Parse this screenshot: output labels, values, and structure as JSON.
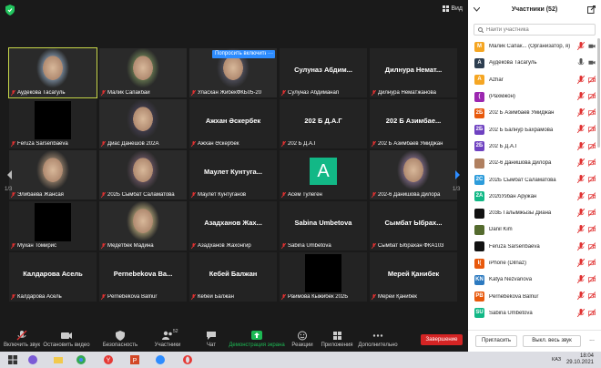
{
  "topbar": {
    "view_label": "Вид"
  },
  "ask_button": {
    "label": "Попросить включить",
    "more": "···"
  },
  "grid": {
    "page_left": "1/3",
    "page_right": "1/3",
    "tiles": [
      {
        "name": "Аудекова Тасагуль",
        "type": "photo",
        "active": true
      },
      {
        "name": "Малик Сапакбай",
        "type": "photo"
      },
      {
        "name": "Уласхан ЖибекФКБ05-20",
        "type": "photo"
      },
      {
        "name": "Сулуназ Абдиманап",
        "center": "Сулуназ Абдим..."
      },
      {
        "name": "Дилнура Нематжанова",
        "center": "Дилнура Немат..."
      },
      {
        "name": "Feruza Sarsenbaeva",
        "type": "black"
      },
      {
        "name": "Диас Данешов 202А",
        "type": "photo"
      },
      {
        "name": "Ажхан Әскербек",
        "center": "Ажхан Әскербек"
      },
      {
        "name": "202 Б Д.А.Г",
        "center": "202 Б Д.А.Г"
      },
      {
        "name": "202 Б Азимбаев Умиджан",
        "center": "202 Б Азимбае..."
      },
      {
        "name": "Элибаева Жансая",
        "type": "photo"
      },
      {
        "name": "202Б Сымбат Саламатова",
        "type": "photo"
      },
      {
        "name": "Маулет Кунтуганов",
        "center": "Маулет Кунтуга..."
      },
      {
        "name": "Асем Тулеген",
        "type": "avatar",
        "initial": "A"
      },
      {
        "name": "202-6 Данишова Дилора",
        "type": "photo"
      },
      {
        "name": "Мухан Томирис",
        "type": "black"
      },
      {
        "name": "Медетбек Мадина",
        "type": "photo"
      },
      {
        "name": "Азадханов Жахонгир",
        "center": "Азадханов Жах..."
      },
      {
        "name": "Sabina Umbetova",
        "center": "Sabina Umbetova"
      },
      {
        "name": "Сымбат Ыбрахан ФКА103",
        "center": "Сымбат Ыбрах..."
      },
      {
        "name": "Калдарова Асель",
        "center": "Калдарова Асель"
      },
      {
        "name": "Pernebekova Balnur",
        "center": "Pernebekova Ba..."
      },
      {
        "name": "Кебей Балжан",
        "center": "Кебей Балжан"
      },
      {
        "name": "Раимова Кыжибек 202Б",
        "type": "black"
      },
      {
        "name": "Мерей Қанибек",
        "center": "Мерей Қанибек"
      }
    ]
  },
  "toolbar": {
    "audio": "Включить звук",
    "video": "Остановить видео",
    "security": "Безопасность",
    "participants": "Участники",
    "participants_count": "52",
    "chat": "Чат",
    "share": "Демонстрация экрана",
    "reactions": "Реакции",
    "apps": "Приложения",
    "more": "Дополнительно",
    "end": "Завершение"
  },
  "panel": {
    "title": "Участники (52)",
    "search_placeholder": "Найти участника",
    "participants": [
      {
        "name": "Малик Сапак... (Организатор, я)",
        "initial": "M",
        "color": "#f5a623",
        "video": true
      },
      {
        "name": "Аудекова Тасагуль",
        "initial": "A",
        "color": "#2d3e50",
        "mic_on": true,
        "video": true
      },
      {
        "name": "Azhar",
        "initial": "A",
        "color": "#f5a623"
      },
      {
        "name": "(Рахмжон)",
        "initial": "(",
        "color": "#9c27b0"
      },
      {
        "name": "202 Б Азимбаев Умиджан",
        "initial": "2Б",
        "color": "#e8590c"
      },
      {
        "name": "202 Б Балнур Бахрамова",
        "initial": "2Б",
        "color": "#6f42c1"
      },
      {
        "name": "202 Б Д.А.Г",
        "initial": "2Б",
        "color": "#6f42c1"
      },
      {
        "name": "202-6 Данишова Дилора",
        "initial": "",
        "color": "#b08060"
      },
      {
        "name": "202Б Сымбат Саламатова",
        "initial": "2С",
        "color": "#2d9cdb"
      },
      {
        "name": "202бУзбан Аружан",
        "initial": "2А",
        "color": "#12b886"
      },
      {
        "name": "203Б Галымжызы Диана",
        "initial": "",
        "color": "#111"
      },
      {
        "name": "Danil Kim",
        "initial": "",
        "color": "#556b2f"
      },
      {
        "name": "Feruza Sarsenbaeva",
        "initial": "",
        "color": "#111"
      },
      {
        "name": "iPhone (Dilnaz)",
        "initial": "I(",
        "color": "#e8590c"
      },
      {
        "name": "Katya Nezvanova",
        "initial": "KN",
        "color": "#2d7ac0"
      },
      {
        "name": "Pernebekova Balnur",
        "initial": "PB",
        "color": "#e8590c"
      },
      {
        "name": "Sabina Umbetova",
        "initial": "SU",
        "color": "#12b886"
      }
    ],
    "invite": "Пригласить",
    "mute_all": "Выкл. весь звук",
    "more": "..."
  },
  "taskbar": {
    "lang": "КАЗ",
    "time": "18:04",
    "date": "29.10.2021"
  }
}
